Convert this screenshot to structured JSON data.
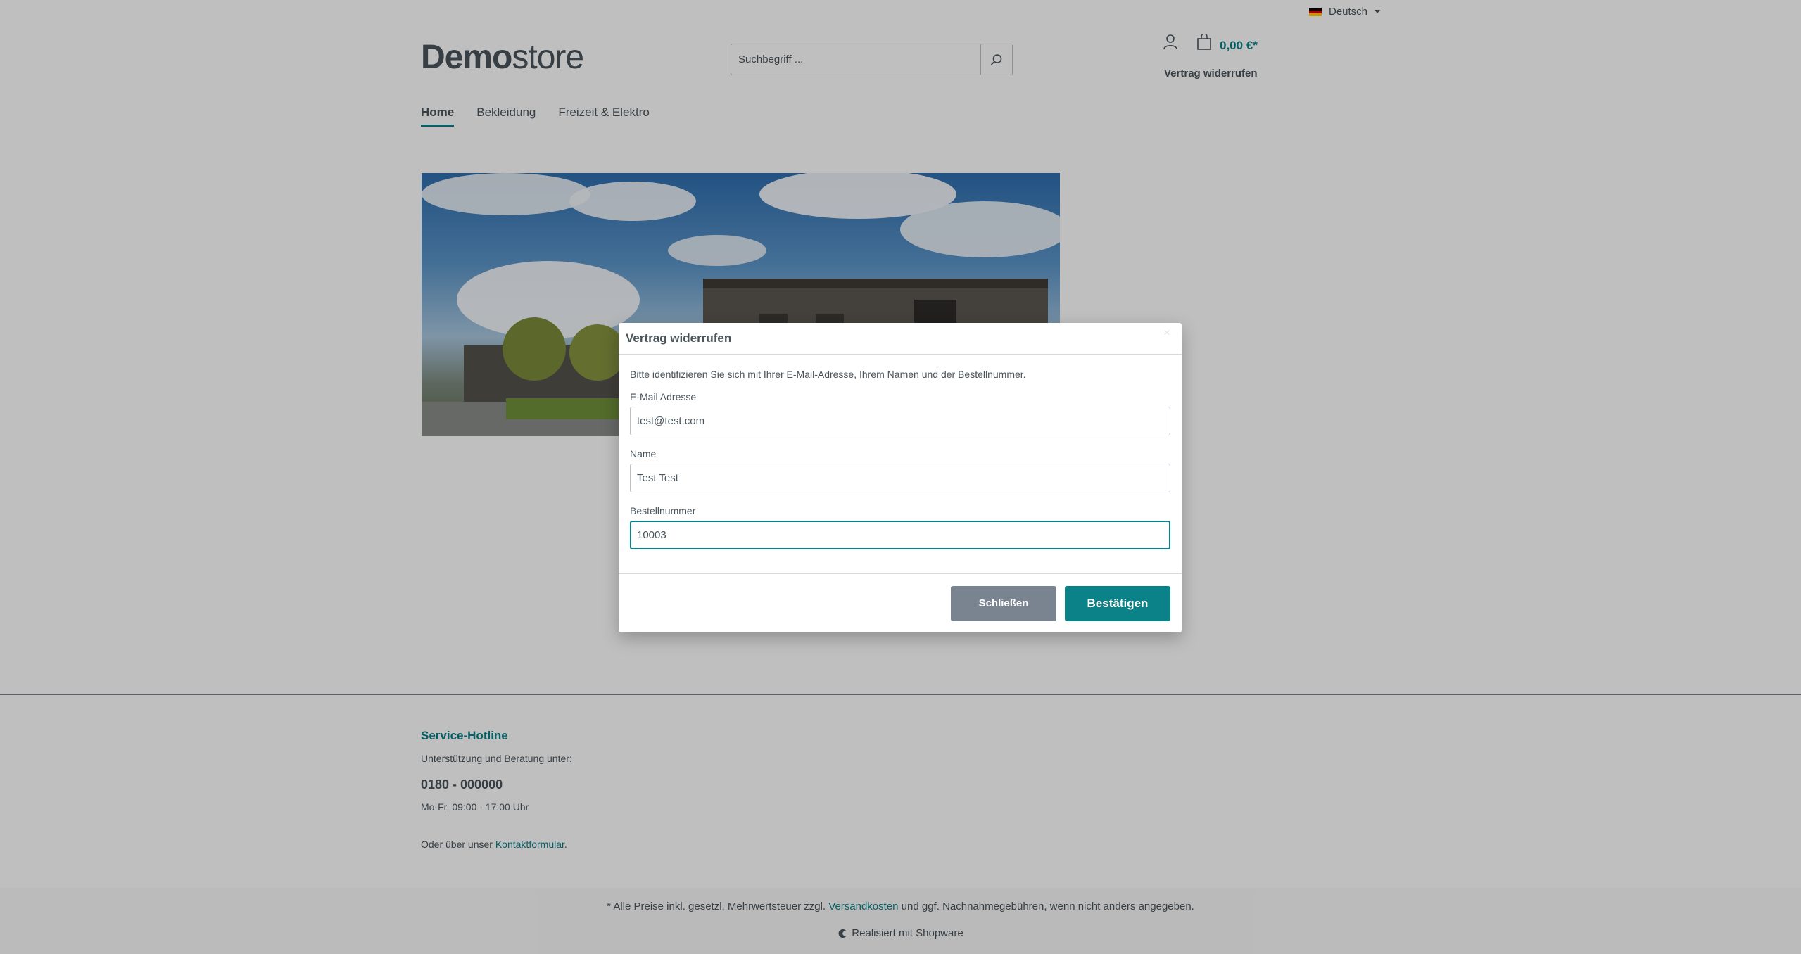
{
  "header": {
    "language": "Deutsch",
    "logo_bold": "Demo",
    "logo_light": "store",
    "search_placeholder": "Suchbegriff ...",
    "cart_total": "0,00 €*",
    "revoke_link": "Vertrag widerrufen"
  },
  "nav": [
    {
      "label": "Home",
      "active": true
    },
    {
      "label": "Bekleidung",
      "active": false
    },
    {
      "label": "Freizeit & Elektro",
      "active": false
    }
  ],
  "footer": {
    "hotline_title": "Service-Hotline",
    "support_text": "Unterstützung und Beratung unter:",
    "phone": "0180 - 000000",
    "hours": "Mo-Fr, 09:00 - 17:00 Uhr",
    "contact_prefix": "Oder über unser ",
    "contact_link": "Kontaktformular",
    "contact_suffix": ".",
    "note_prefix": "* Alle Preise inkl. gesetzl. Mehrwertsteuer zzgl. ",
    "note_link": "Versandkosten",
    "note_suffix": " und ggf. Nachnahmegebühren, wenn nicht anders angegeben.",
    "powered_by": "Realisiert mit Shopware"
  },
  "modal": {
    "title": "Vertrag widerrufen",
    "close_symbol": "×",
    "intro": "Bitte identifizieren Sie sich mit Ihrer E-Mail-Adresse, Ihrem Namen und der Bestellnummer.",
    "email_label": "E-Mail Adresse",
    "email_value": "test@test.com",
    "name_label": "Name",
    "name_value": "Test Test",
    "order_label": "Bestellnummer",
    "order_value": "10003",
    "close_button": "Schließen",
    "confirm_button": "Bestätigen"
  },
  "colors": {
    "accent": "#0b8188",
    "secondary_button": "#798490",
    "text": "#4a545b"
  }
}
